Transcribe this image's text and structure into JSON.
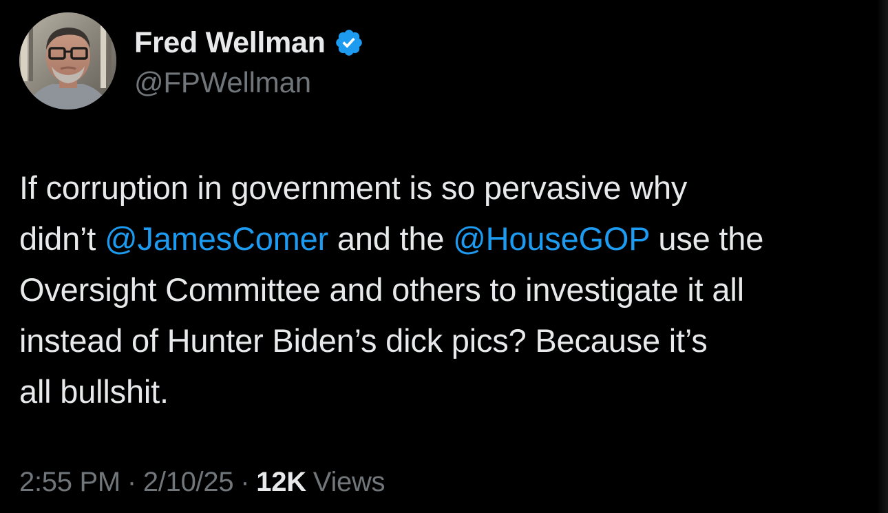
{
  "author": {
    "display_name": "Fred Wellman",
    "handle": "@FPWellman",
    "verified": true,
    "avatar_icon": "profile-photo"
  },
  "tweet": {
    "lines": [
      [
        {
          "text": "If corruption in government is so pervasive why"
        }
      ],
      [
        {
          "text": "didn’t "
        },
        {
          "text": "@JamesComer",
          "mention": true
        },
        {
          "text": " and the "
        },
        {
          "text": "@HouseGOP",
          "mention": true
        },
        {
          "text": " use the"
        }
      ],
      [
        {
          "text": "Oversight Committee and others to investigate it all"
        }
      ],
      [
        {
          "text": "instead of Hunter Biden’s dick pics? Because it’s"
        }
      ],
      [
        {
          "text": "all bullshit."
        }
      ]
    ]
  },
  "meta": {
    "time": "2:55 PM",
    "separator": "·",
    "date": "2/10/25",
    "views_count": "12K",
    "views_label": "Views"
  },
  "colors": {
    "background": "#000000",
    "text": "#e7e9ea",
    "secondary": "#71767b",
    "accent": "#1d9bf0"
  }
}
